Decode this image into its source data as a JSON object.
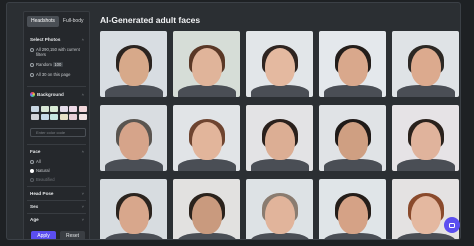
{
  "tabs": [
    {
      "label": "Headshots"
    },
    {
      "label": "Full-body"
    }
  ],
  "page_title": "AI-Generated adult faces",
  "select_photos": {
    "title": "Select Photos",
    "options": [
      {
        "label": "All 290,150 with current filters"
      },
      {
        "label": "Random",
        "count": "100"
      },
      {
        "label": "All 30 on this page"
      }
    ]
  },
  "background": {
    "title": "Background",
    "swatches": [
      "#c9d7e3",
      "#d8e6d6",
      "#d9ecd6",
      "#e5ddea",
      "#eed9e7",
      "#f3d7db",
      "#d2d4d8",
      "#c6d8e8",
      "#c5e7e1",
      "#e7e2c8",
      "#e7cfd8",
      "#f2e4e4"
    ],
    "input_placeholder": "Enter color code"
  },
  "face": {
    "title": "Face",
    "options": [
      {
        "label": "All"
      },
      {
        "label": "Natural"
      },
      {
        "label": "Beautified"
      }
    ]
  },
  "filters": [
    {
      "label": "Head Pose"
    },
    {
      "label": "Sex"
    },
    {
      "label": "Age"
    }
  ],
  "buttons": {
    "apply": "Apply",
    "reset": "Reset"
  },
  "photos": [
    {
      "bg": "#d8dde2",
      "skin": "#d7a98a",
      "hair": "#2b2420"
    },
    {
      "bg": "#d6ddd7",
      "skin": "#e0b49a",
      "hair": "#5a3826"
    },
    {
      "bg": "#e2e6e9",
      "skin": "#e4b9a0",
      "hair": "#2e2420"
    },
    {
      "bg": "#e4e8ec",
      "skin": "#d9a88c",
      "hair": "#231d1a"
    },
    {
      "bg": "#dfe3e6",
      "skin": "#dcaa8e",
      "hair": "#2c2824"
    },
    {
      "bg": "#d9dde1",
      "skin": "#d6a48a",
      "hair": "#5a5550"
    },
    {
      "bg": "#e1e4e7",
      "skin": "#e2b59b",
      "hair": "#6e4430"
    },
    {
      "bg": "#e3e3e5",
      "skin": "#dcae94",
      "hair": "#2a201c"
    },
    {
      "bg": "#e0e3e6",
      "skin": "#cf9f82",
      "hair": "#1f1a18"
    },
    {
      "bg": "#e6e3e6",
      "skin": "#e0b39c",
      "hair": "#2a211c"
    },
    {
      "bg": "#d7dce0",
      "skin": "#d8a78c",
      "hair": "#2b241f"
    },
    {
      "bg": "#e2e1e0",
      "skin": "#c99a7e",
      "hair": "#2a221c"
    },
    {
      "bg": "#dde2e5",
      "skin": "#e1b49b",
      "hair": "#8a7c70"
    },
    {
      "bg": "#e0e5e8",
      "skin": "#d5a286",
      "hair": "#241d19"
    },
    {
      "bg": "#e4e2e2",
      "skin": "#e4b8a0",
      "hair": "#8a4a2c"
    }
  ]
}
